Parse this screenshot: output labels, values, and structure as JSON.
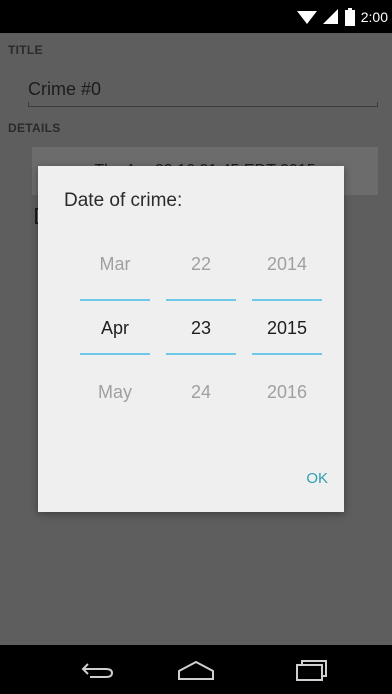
{
  "status_bar": {
    "time": "2:00",
    "icons": [
      "wifi-icon",
      "signal-icon",
      "battery-icon"
    ]
  },
  "form": {
    "title_section_label": "TITLE",
    "title_value": "Crime #0",
    "details_section_label": "DETAILS",
    "date_button_label": "Thu Apr 23 16:21:45 EDT 2015"
  },
  "dialog": {
    "title": "Date of crime:",
    "month": {
      "prev": "Mar",
      "selected": "Apr",
      "next": "May"
    },
    "day": {
      "prev": "22",
      "selected": "23",
      "next": "24"
    },
    "year": {
      "prev": "2014",
      "selected": "2015",
      "next": "2016"
    },
    "ok_label": "OK"
  },
  "nav_bar": {
    "buttons": [
      "back-icon",
      "home-icon",
      "recents-icon"
    ]
  },
  "colors": {
    "accent": "#6ec8e8",
    "ok_text": "#2f9fb0",
    "dialog_bg": "#efefef",
    "scrim": "#5e5e5e"
  }
}
